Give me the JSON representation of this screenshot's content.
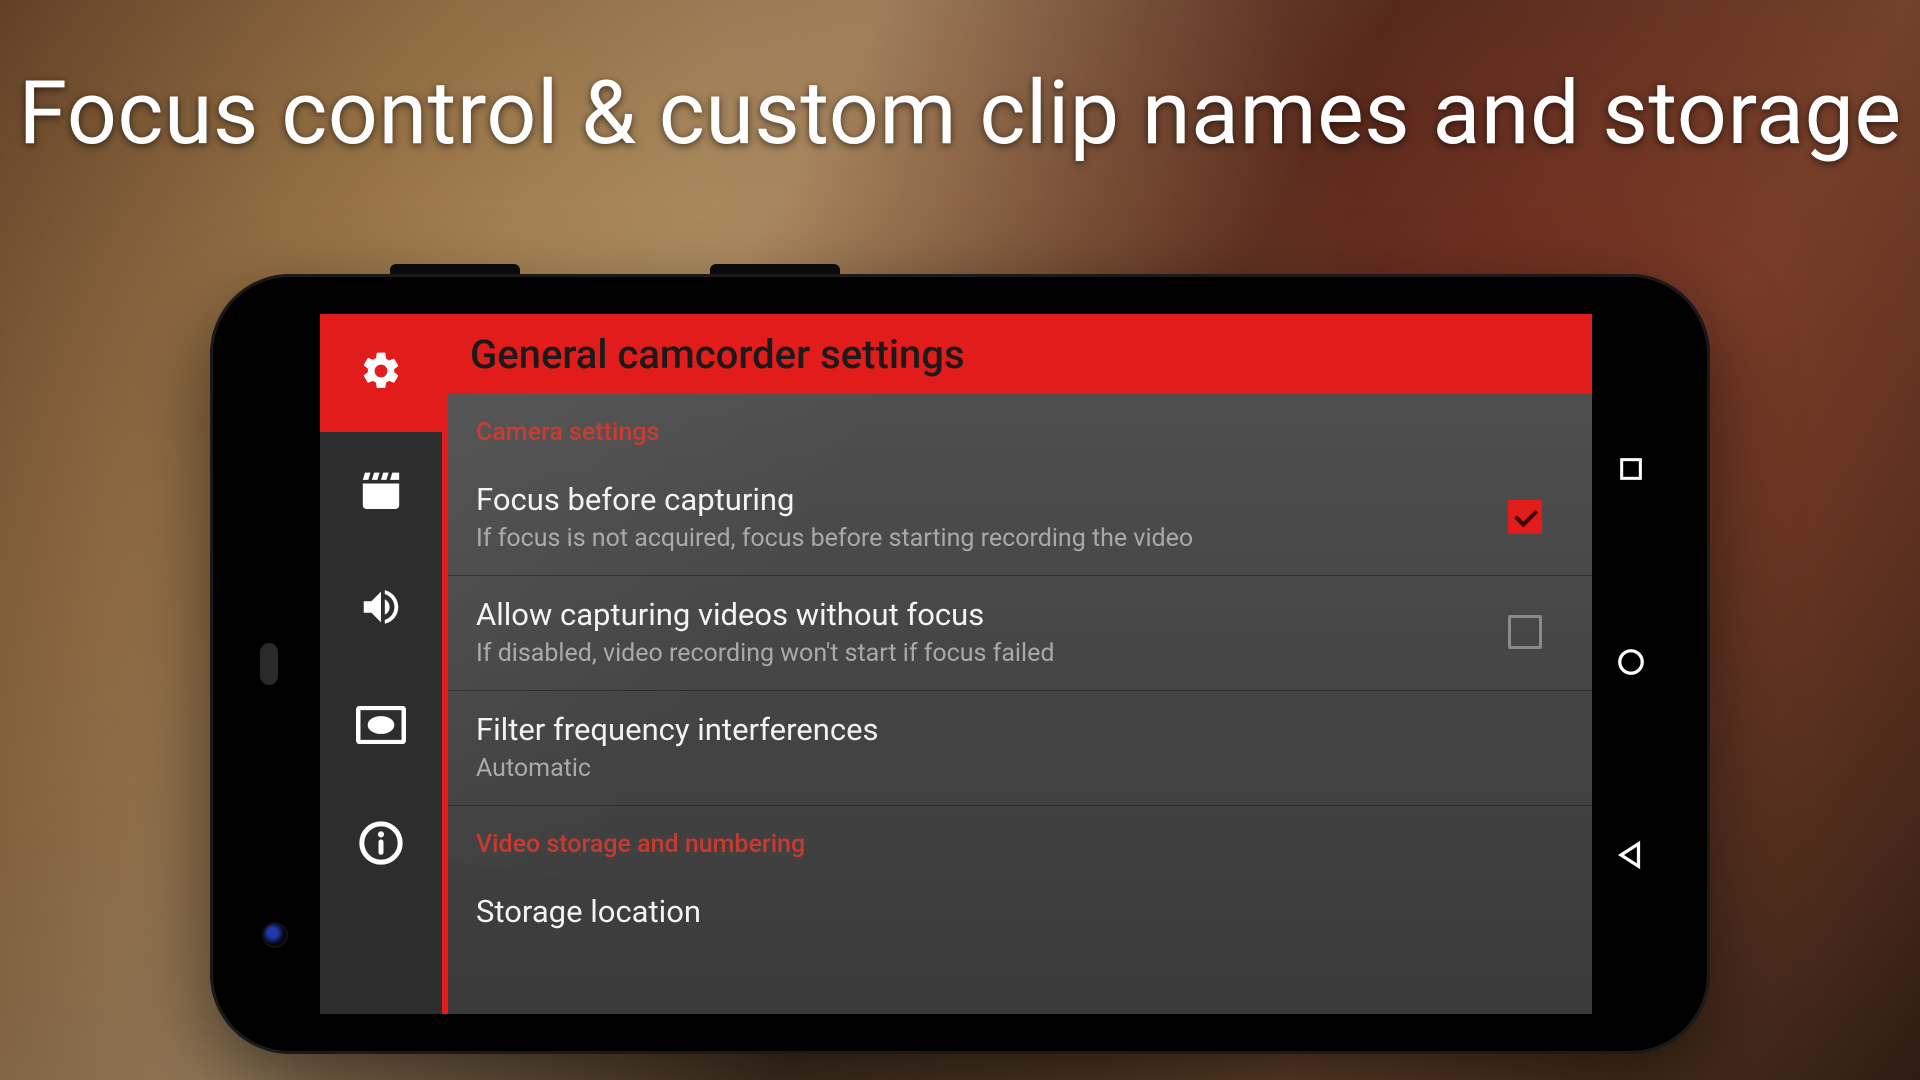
{
  "headline": "Focus control & custom clip names and storage",
  "accent_color": "#e21b1b",
  "app": {
    "title": "General camcorder settings",
    "sidebar": {
      "items": [
        {
          "icon": "gear-icon",
          "active": true
        },
        {
          "icon": "clapperboard-icon",
          "active": false
        },
        {
          "icon": "volume-icon",
          "active": false
        },
        {
          "icon": "display-eye-icon",
          "active": false
        },
        {
          "icon": "info-icon",
          "active": false
        }
      ]
    },
    "sections": [
      {
        "label": "Camera settings",
        "rows": [
          {
            "title": "Focus before capturing",
            "sub": "If focus is not acquired, focus before starting recording the video",
            "kind": "checkbox",
            "checked": true
          },
          {
            "title": "Allow capturing videos without focus",
            "sub": "If disabled, video recording won't start if focus failed",
            "kind": "checkbox",
            "checked": false
          },
          {
            "title": "Filter frequency interferences",
            "sub": "Automatic",
            "kind": "value"
          }
        ]
      },
      {
        "label": "Video storage and numbering",
        "rows": [
          {
            "title": "Storage location",
            "sub": "",
            "kind": "value"
          }
        ]
      }
    ]
  },
  "android_nav": {
    "items": [
      "recent-apps",
      "home",
      "back"
    ]
  }
}
